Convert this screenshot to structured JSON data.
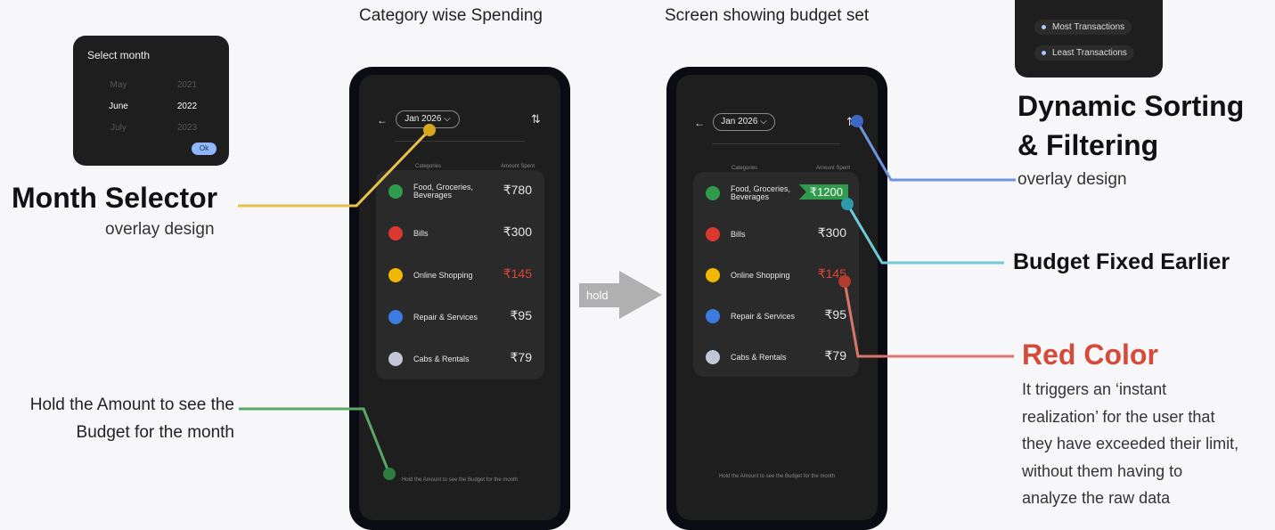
{
  "captions": {
    "left_phone": "Category wise Spending",
    "right_phone": "Screen showing budget set"
  },
  "month_overlay": {
    "title": "Select month",
    "months": [
      "May",
      "June",
      "July"
    ],
    "years": [
      "2021",
      "2022",
      "2023"
    ],
    "ok_label": "Ok"
  },
  "sort_overlay": {
    "items": [
      "Most Transactions",
      "Least Transactions"
    ]
  },
  "annotations": {
    "month_selector_title": "Month Selector",
    "month_selector_sub": "overlay design",
    "hold_hint_line1": "Hold the Amount to see the",
    "hold_hint_line2": "Budget for the month",
    "sorting_title_line1": "Dynamic Sorting",
    "sorting_title_line2": "& Filtering",
    "sorting_sub": "overlay design",
    "budget_fixed": "Budget Fixed Earlier",
    "red_color_title": "Red Color",
    "red_color_desc": [
      "It triggers an ‘instant",
      "realization’ for the user that",
      "they have exceeded their limit,",
      "without them having to",
      "analyze the raw data"
    ]
  },
  "hold_arrow_label": "hold",
  "phone_common": {
    "back_icon": "←",
    "month_pill": "Jan 2026",
    "chevron_icon": "⌵",
    "sort_icon": "⇅",
    "col_categories": "Categories",
    "col_amount": "Amount Spent",
    "footer": "Hold the Amount to see the Budget for the month"
  },
  "categories": [
    {
      "line1": "Food, Groceries,",
      "line2": "Beverages",
      "color": "#2e9c4c"
    },
    {
      "line1": "Bills",
      "line2": "",
      "color": "#d9372f"
    },
    {
      "line1": "Online Shopping",
      "line2": "",
      "color": "#f0b800"
    },
    {
      "line1": "Repair & Services",
      "line2": "",
      "color": "#3c7be0"
    },
    {
      "line1": "Cabs & Rentals",
      "line2": "",
      "color": "#c2c6d6"
    }
  ],
  "left_amounts": [
    "₹780",
    "₹300",
    "₹145",
    "₹95",
    "₹79"
  ],
  "right_amounts": [
    "₹1200",
    "₹300",
    "₹145",
    "₹95",
    "₹79"
  ],
  "colors": {
    "yellow_line": "#e8c24a",
    "green_line": "#5aa867",
    "blue_line": "#6f95dd",
    "teal_line": "#6fcad8",
    "red_line": "#d9776b"
  }
}
